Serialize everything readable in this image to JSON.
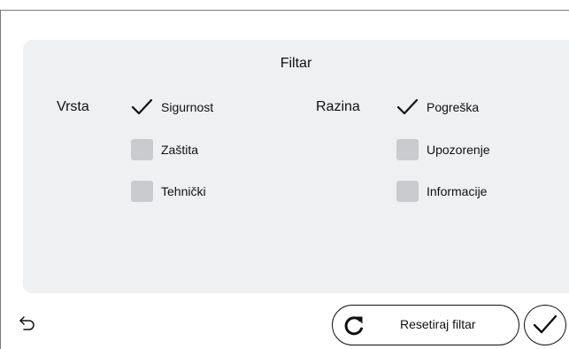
{
  "filter": {
    "title": "Filtar",
    "type_group": {
      "label": "Vrsta",
      "options": [
        {
          "label": "Sigurnost",
          "checked": true
        },
        {
          "label": "Zaštita",
          "checked": false
        },
        {
          "label": "Tehnički",
          "checked": false
        }
      ]
    },
    "level_group": {
      "label": "Razina",
      "options": [
        {
          "label": "Pogreška",
          "checked": true
        },
        {
          "label": "Upozorenje",
          "checked": false
        },
        {
          "label": "Informacije",
          "checked": false
        }
      ]
    }
  },
  "footer": {
    "back_icon": "back-arrow-icon",
    "reset_label": "Resetiraj filtar",
    "reset_icon": "refresh-icon",
    "confirm_icon": "checkmark-icon"
  },
  "colors": {
    "panel_background": "#eef0f2",
    "unchecked_box": "#c9cbce",
    "text": "#111111",
    "frame": "#7a7a7a"
  }
}
